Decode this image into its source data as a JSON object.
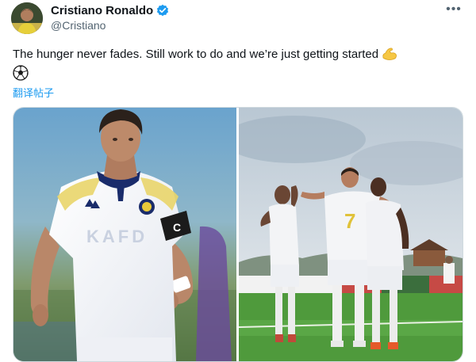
{
  "tweet": {
    "author": {
      "display_name": "Cristiano Ronaldo",
      "handle": "@Cristiano",
      "verified": true,
      "avatar_icon": "avatar"
    },
    "more_icon": "more-horizontal-icon",
    "more_glyph": "•••",
    "text": "The hunger never fades. Still work to do and we’re just getting started",
    "emojis": [
      "flexed-biceps-emoji",
      "soccer-ball-emoji"
    ],
    "translate_label": "翻译帖子",
    "media": {
      "count": 2,
      "photos": [
        {
          "jersey_text": "KAFD"
        },
        {
          "jersey_number": "7"
        }
      ]
    }
  },
  "colors": {
    "text_primary": "#0f1419",
    "text_secondary": "#536471",
    "link": "#1d9bf0",
    "verified_badge": "#1d9bf0",
    "border": "#cfd9de"
  }
}
